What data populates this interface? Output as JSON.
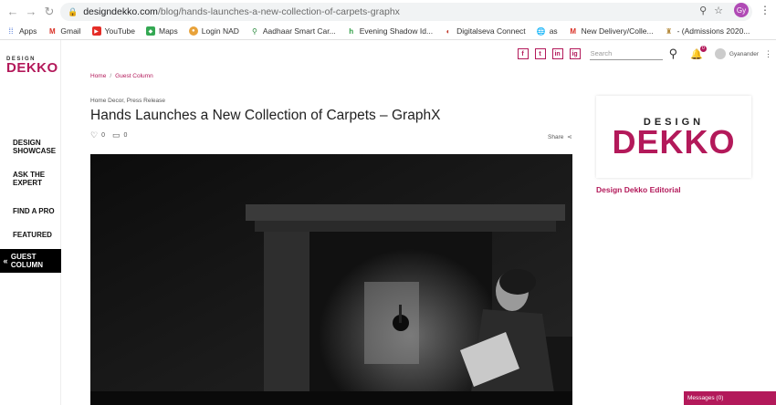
{
  "browser": {
    "url_host": "designdekko.com",
    "url_path": "/blog/hands-launches-a-new-collection-of-carpets-graphx",
    "profile_initials": "Gy",
    "bookmarks": [
      {
        "label": "Apps",
        "icon": "apps-grid-icon"
      },
      {
        "label": "Gmail",
        "icon": "gmail-icon"
      },
      {
        "label": "YouTube",
        "icon": "youtube-icon"
      },
      {
        "label": "Maps",
        "icon": "maps-icon"
      },
      {
        "label": "Login NAD",
        "icon": "login-nad-icon"
      },
      {
        "label": "Aadhaar Smart Car...",
        "icon": "aadhaar-icon"
      },
      {
        "label": "Evening Shadow Id...",
        "icon": "evening-shadow-icon"
      },
      {
        "label": "Digitalseva Connect",
        "icon": "digitalseva-icon"
      },
      {
        "label": "as",
        "icon": "globe-icon"
      },
      {
        "label": "New Delivery/Colle...",
        "icon": "gmail-icon"
      },
      {
        "label": "- (Admissions 2020...",
        "icon": "admissions-icon"
      }
    ]
  },
  "sidebar": {
    "logo_top": "DESIGN",
    "logo_bottom": "DEKKO",
    "items": [
      {
        "line1": "DESIGN",
        "line2": "SHOWCASE"
      },
      {
        "line1": "ASK THE",
        "line2": "EXPERT"
      },
      {
        "line1": "FIND A PRO",
        "line2": ""
      },
      {
        "line1": "FEATURED",
        "line2": ""
      },
      {
        "line1": "GUEST COLUMN",
        "line2": ""
      }
    ]
  },
  "header": {
    "social": [
      "f",
      "t",
      "in",
      "ig"
    ],
    "search_placeholder": "Search",
    "notification_count": "0",
    "user_name": "Gyanander"
  },
  "article": {
    "breadcrumb_home": "Home",
    "breadcrumb_current": "Guest Column",
    "categories": "Home Decor, Press Release",
    "title": "Hands Launches a New Collection of Carpets – GraphX",
    "likes": "0",
    "comments": "0",
    "share_label": "Share"
  },
  "editorial": {
    "logo_top": "DESIGN",
    "logo_bottom": "DEKKO",
    "name": "Design Dekko Editorial"
  },
  "messages_label": "Messages (0)",
  "colors": {
    "brand": "#b3195a"
  }
}
